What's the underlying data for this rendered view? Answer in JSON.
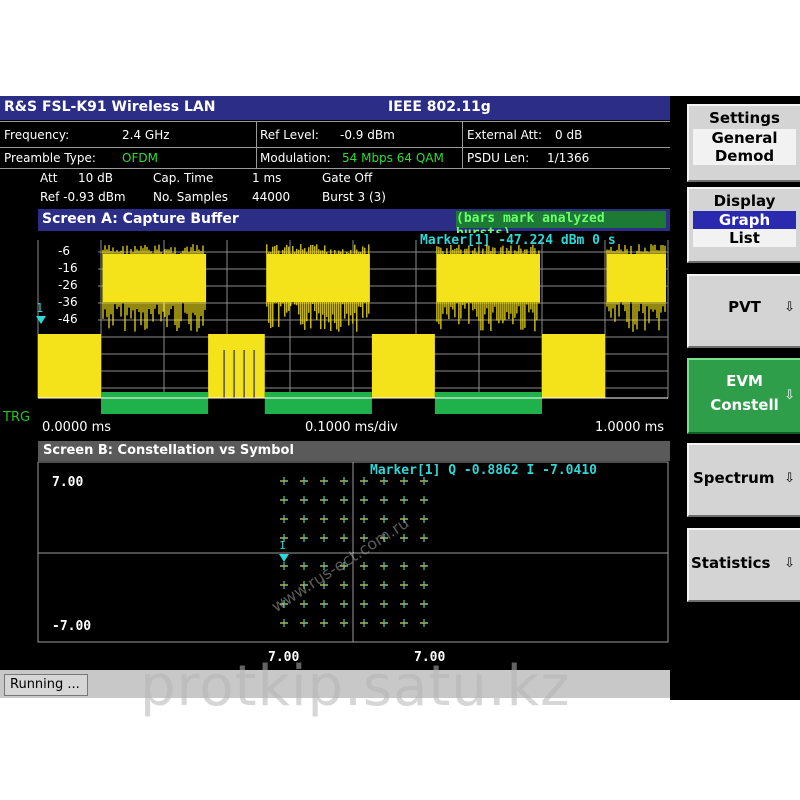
{
  "title_bar": {
    "app": "R&S FSL-K91 Wireless LAN",
    "standard": "IEEE 802.11g"
  },
  "info_rows": {
    "frequency_label": "Frequency:",
    "frequency_value": "2.4 GHz",
    "ref_level_label": "Ref Level:",
    "ref_level_value": "-0.9 dBm",
    "ext_att_label": "External Att:",
    "ext_att_value": "0 dB",
    "preamble_label": "Preamble Type:",
    "preamble_value": "OFDM",
    "modulation_label": "Modulation:",
    "modulation_value": "54 Mbps 64 QAM",
    "psdu_label": "PSDU Len:",
    "psdu_value": "1/1366"
  },
  "settings_line1": {
    "att_label": "Att",
    "att_value": "10 dB",
    "cap_label": "Cap. Time",
    "cap_value": "1 ms",
    "gate": "Gate Off"
  },
  "settings_line2": {
    "ref": "Ref  -0.93 dBm",
    "samples_label": "No. Samples",
    "samples_value": "44000",
    "burst": "Burst 3 (3)"
  },
  "screen_a": {
    "title": "Screen A: Capture Buffer",
    "note": "(bars mark analyzed bursts)",
    "marker": "Marker[1]  -47.224 dBm  0 s",
    "trg_label": "TRG",
    "x_start": "0.0000 ms",
    "x_div": "0.1000 ms/div",
    "x_end": "1.0000 ms",
    "marker_flag": "1"
  },
  "screen_b": {
    "title": "Screen B: Constellation vs Symbol",
    "marker": "Marker[1]  Q   -0.8862  I  -7.0410",
    "y_top": "7.00",
    "y_bottom": "-7.00",
    "x_left": "7.00",
    "x_right": "7.00",
    "marker_flag": "1"
  },
  "softkeys": {
    "settings": {
      "title": "Settings",
      "line1": "General",
      "line2": "Demod"
    },
    "display": {
      "title": "Display",
      "opt1": "Graph",
      "opt2": "List"
    },
    "pvt": "PVT",
    "evm_line1": "EVM",
    "evm_line2": "Constell",
    "spectrum": "Spectrum",
    "statistics": "Statistics",
    "arrow": "⇩"
  },
  "status": {
    "running": "Running ..."
  },
  "watermarks": {
    "main": "protkip.satu.kz",
    "diag": "www.rus-ect.com.ru"
  },
  "chart_data": [
    {
      "type": "line",
      "title": "Screen A: Capture Buffer",
      "y_tick_labels": [
        "-6",
        "-16",
        "-26",
        "-36",
        "-46"
      ],
      "x_tick_labels": [
        "0.0000 ms",
        "0.1000 ms/div",
        "1.0000 ms"
      ],
      "bursts": [
        {
          "x_start_ms": 0.0,
          "x_end_ms": 0.1,
          "level": "preamble"
        },
        {
          "x_start_ms": 0.1,
          "x_end_ms": 0.27,
          "level": "data"
        },
        {
          "x_start_ms": 0.27,
          "x_end_ms": 0.36,
          "level": "preamble"
        },
        {
          "x_start_ms": 0.36,
          "x_end_ms": 0.53,
          "level": "data"
        },
        {
          "x_start_ms": 0.53,
          "x_end_ms": 0.63,
          "level": "preamble"
        },
        {
          "x_start_ms": 0.63,
          "x_end_ms": 0.8,
          "level": "data"
        },
        {
          "x_start_ms": 0.8,
          "x_end_ms": 0.9,
          "level": "preamble"
        },
        {
          "x_start_ms": 0.9,
          "x_end_ms": 1.0,
          "level": "data"
        }
      ],
      "analyzed_bursts_ms": [
        [
          0.1,
          0.27
        ],
        [
          0.36,
          0.53
        ],
        [
          0.63,
          0.8
        ]
      ],
      "grid": true
    },
    {
      "type": "scatter",
      "title": "Screen B: Constellation vs Symbol",
      "ylim": [
        -7.0,
        7.0
      ],
      "columns": 4,
      "rows": 8,
      "grid": true
    }
  ]
}
